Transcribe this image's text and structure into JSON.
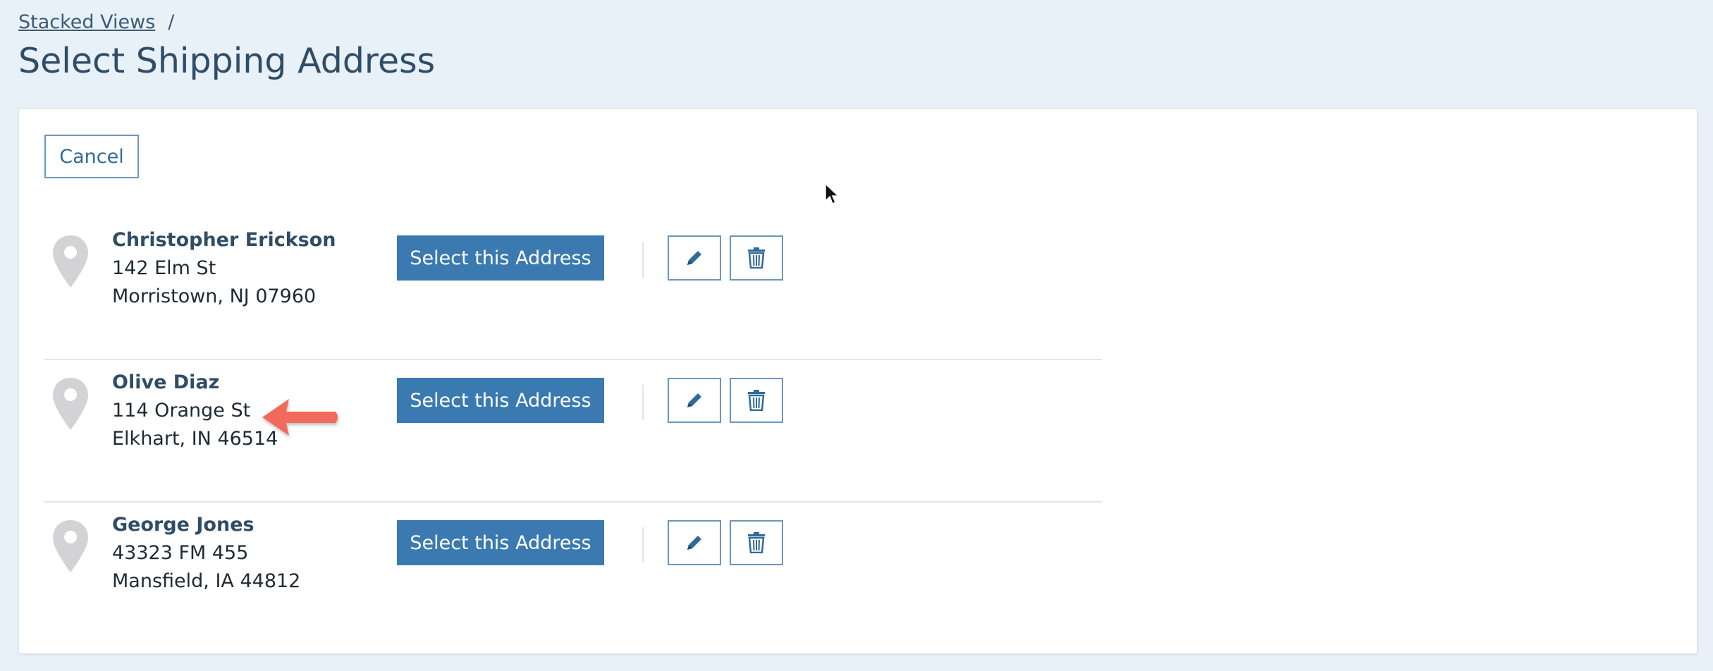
{
  "breadcrumb": {
    "link": "Stacked Views",
    "separator": "/"
  },
  "page": {
    "title": "Select Shipping Address"
  },
  "actions": {
    "cancel_label": "Cancel"
  },
  "addresses": [
    {
      "name": "Christopher Erickson",
      "line1": "142 Elm St",
      "line2": "Morristown, NJ 07960",
      "select_label": "Select this Address"
    },
    {
      "name": "Olive Diaz",
      "line1": "114 Orange St",
      "line2": "Elkhart, IN 46514",
      "select_label": "Select this Address"
    },
    {
      "name": "George Jones",
      "line1": "43323 FM 455",
      "line2": "Mansfield, IA 44812",
      "select_label": "Select this Address"
    }
  ],
  "icons": {
    "pin": "map-pin-icon",
    "edit": "pencil-icon",
    "delete": "trash-icon",
    "annotation": "red-arrow-icon",
    "cursor": "mouse-cursor-icon"
  },
  "colors": {
    "background": "#e8f0f8",
    "primary": "#3a7ab0",
    "title": "#2f4d66",
    "annotation": "#f26b5b",
    "pin": "#d3d3d6"
  }
}
